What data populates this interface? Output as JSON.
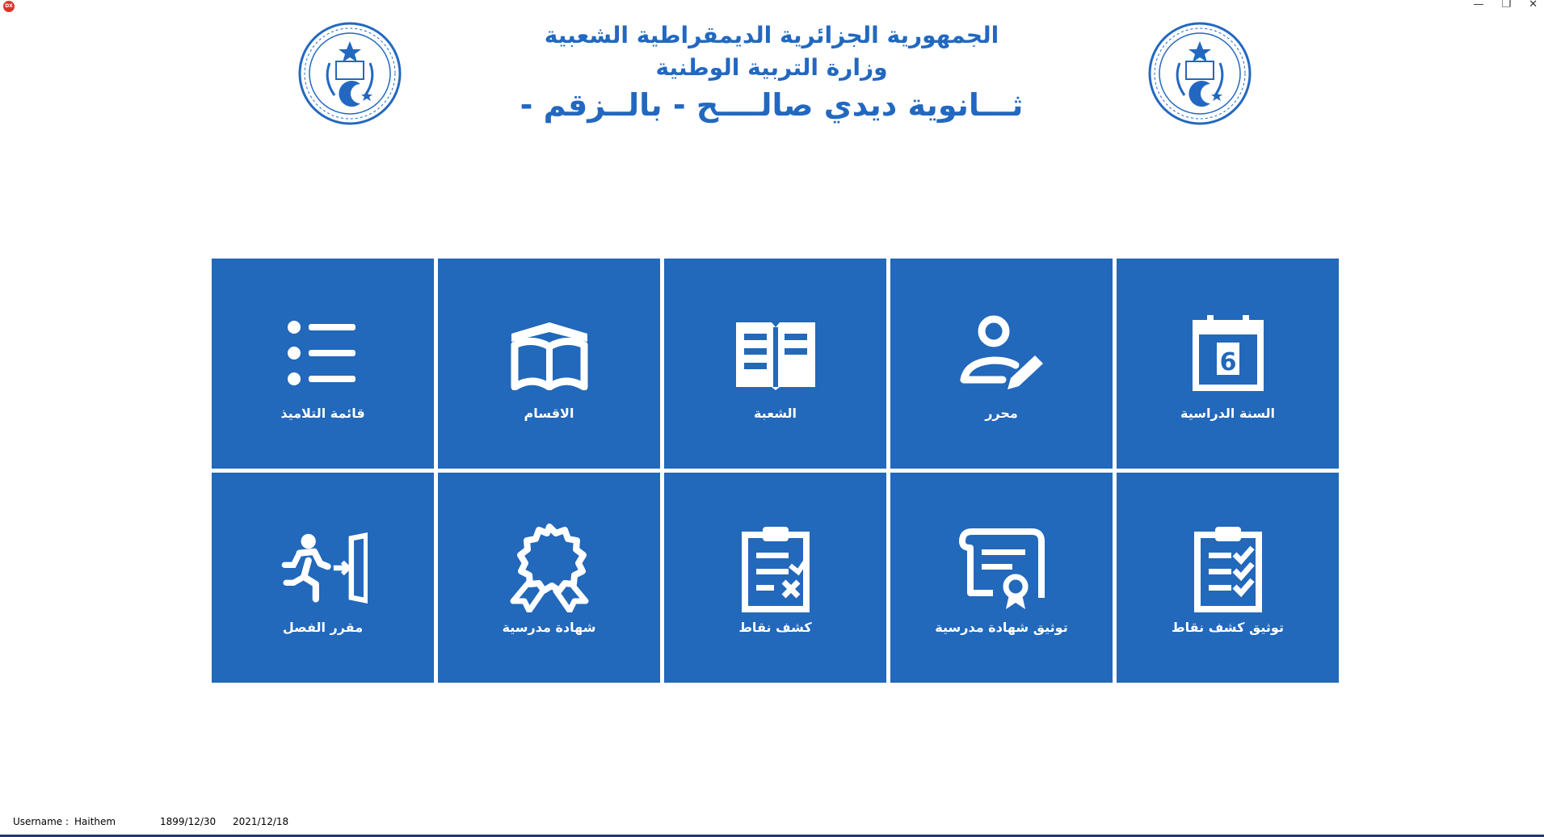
{
  "window": {
    "badge": "DX",
    "controls": [
      "—",
      "❐",
      "✕"
    ]
  },
  "header": {
    "line1": "الجمهورية الجزائرية الديمقراطية الشعبية",
    "line2": "وزارة التربية الوطنية",
    "line3": "ثـــانوية ديدي صالــــح - بالــزقم -"
  },
  "tiles": [
    {
      "label": "قائمة التلاميذ",
      "icon": "list-icon"
    },
    {
      "label": "الاقسام",
      "icon": "open-book-icon"
    },
    {
      "label": "الشعبة",
      "icon": "book-pages-icon"
    },
    {
      "label": "محرر",
      "icon": "user-edit-icon"
    },
    {
      "label": "السنة الدراسية",
      "icon": "calendar-icon"
    },
    {
      "label": "مقرر الفصل",
      "icon": "exit-run-icon"
    },
    {
      "label": "شهادة مدرسية",
      "icon": "award-ribbon-icon"
    },
    {
      "label": "كشف نقاط",
      "icon": "clipboard-cross-icon"
    },
    {
      "label": "توثيق شهادة مدرسية",
      "icon": "certificate-icon"
    },
    {
      "label": "توثيق كشف نقاط",
      "icon": "clipboard-check-icon"
    }
  ],
  "calendar_day": "6",
  "status": {
    "username_label": "Username :",
    "username": "Haithem",
    "date1": "1899/12/30",
    "date2": "2021/12/18"
  },
  "colors": {
    "tile": "#2268bb",
    "title": "#2268c0"
  }
}
